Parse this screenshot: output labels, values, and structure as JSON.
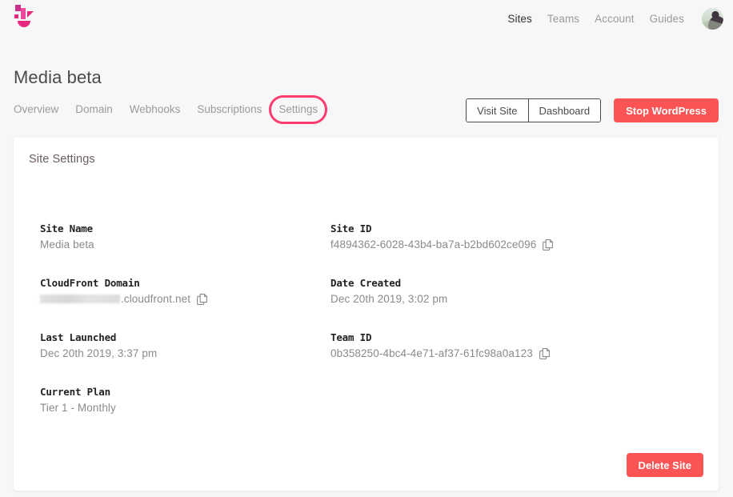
{
  "brand": {
    "logo_icon": "logo-mark",
    "accent_pink": "#e8287f",
    "highlight_ring": "#fb3c6e",
    "danger": "#fb5454"
  },
  "topnav": {
    "items": [
      {
        "label": "Sites",
        "active": true
      },
      {
        "label": "Teams",
        "active": false
      },
      {
        "label": "Account",
        "active": false
      },
      {
        "label": "Guides",
        "active": false
      }
    ],
    "avatar_icon": "user-avatar"
  },
  "header": {
    "title": "Media beta"
  },
  "tabs": [
    {
      "label": "Overview",
      "highlighted": false
    },
    {
      "label": "Domain",
      "highlighted": false
    },
    {
      "label": "Webhooks",
      "highlighted": false
    },
    {
      "label": "Subscriptions",
      "highlighted": false
    },
    {
      "label": "Settings",
      "highlighted": true
    }
  ],
  "actions": {
    "visit_site_label": "Visit Site",
    "dashboard_label": "Dashboard",
    "stop_wordpress_label": "Stop WordPress"
  },
  "card": {
    "title": "Site Settings",
    "fields": [
      {
        "label": "Site Name",
        "value": "Media beta",
        "copyable": false,
        "redacted": false
      },
      {
        "label": "Site ID",
        "value": "f4894362-6028-43b4-ba7a-b2bd602ce096",
        "copyable": true,
        "redacted": false
      },
      {
        "label": "CloudFront Domain",
        "value": ".cloudfront.net",
        "copyable": true,
        "redacted": true
      },
      {
        "label": "Date Created",
        "value": "Dec 20th 2019, 3:02 pm",
        "copyable": false,
        "redacted": false
      },
      {
        "label": "Last Launched",
        "value": "Dec 20th 2019, 3:37 pm",
        "copyable": false,
        "redacted": false
      },
      {
        "label": "Team ID",
        "value": "0b358250-4bc4-4e71-af37-61fc98a0a123",
        "copyable": true,
        "redacted": false
      },
      {
        "label": "Current Plan",
        "value": "Tier 1 - Monthly",
        "copyable": false,
        "redacted": false
      }
    ],
    "delete_label": "Delete Site"
  }
}
